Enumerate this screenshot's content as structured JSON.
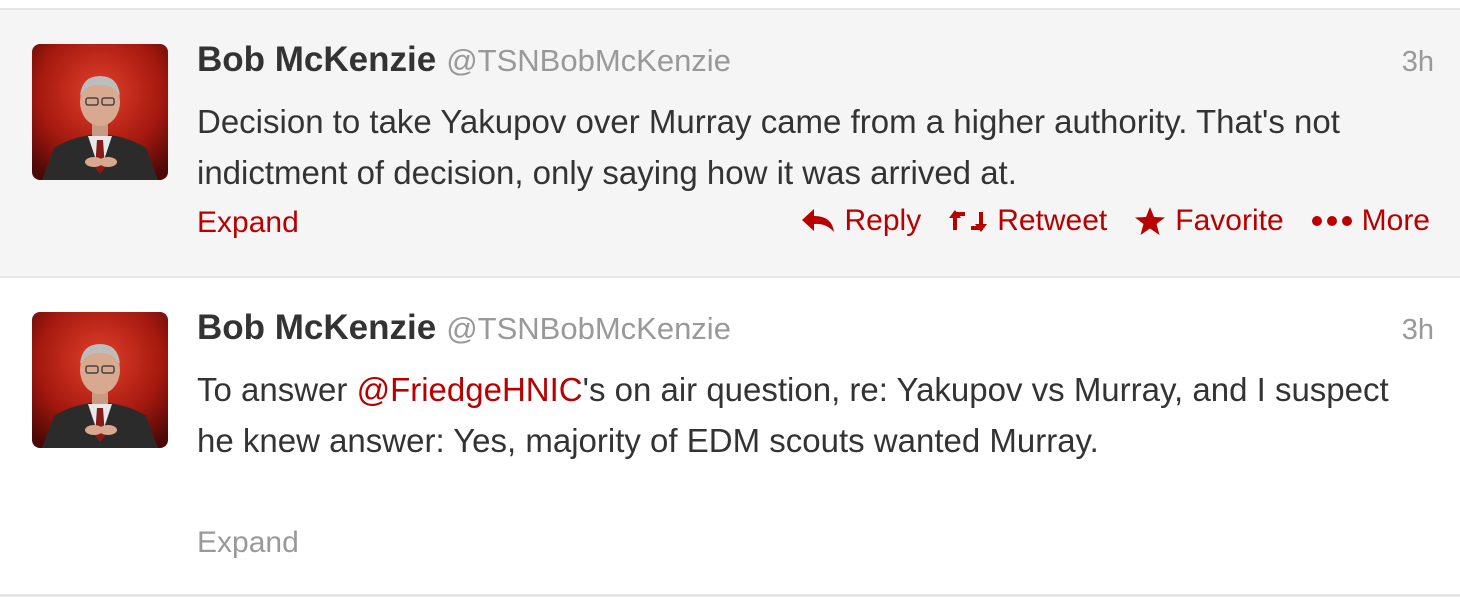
{
  "colors": {
    "link": "#b80000",
    "muted": "#999999",
    "text": "#333333",
    "hover_bg": "#f5f5f5"
  },
  "tweets": [
    {
      "fullname": "Bob McKenzie",
      "username": "@TSNBobMcKenzie",
      "time": "3h",
      "text": "Decision to take Yakupov over Murray came from a higher authority. That's not indictment of decision, only saying how it was arrived at.",
      "expand": "Expand",
      "actions": {
        "reply": "Reply",
        "reply_icon": "reply-icon",
        "retweet": "Retweet",
        "retweet_icon": "retweet-icon",
        "favorite": "Favorite",
        "favorite_icon": "star-icon",
        "more": "More",
        "more_icon": "ellipsis-icon"
      }
    },
    {
      "fullname": "Bob McKenzie",
      "username": "@TSNBobMcKenzie",
      "time": "3h",
      "text_before": "To answer ",
      "mention": "@FriedgeHNIC",
      "text_after": "'s on air question, re: Yakupov vs Murray, and I suspect he knew answer: Yes, majority of EDM scouts wanted Murray.",
      "expand": "Expand"
    }
  ]
}
